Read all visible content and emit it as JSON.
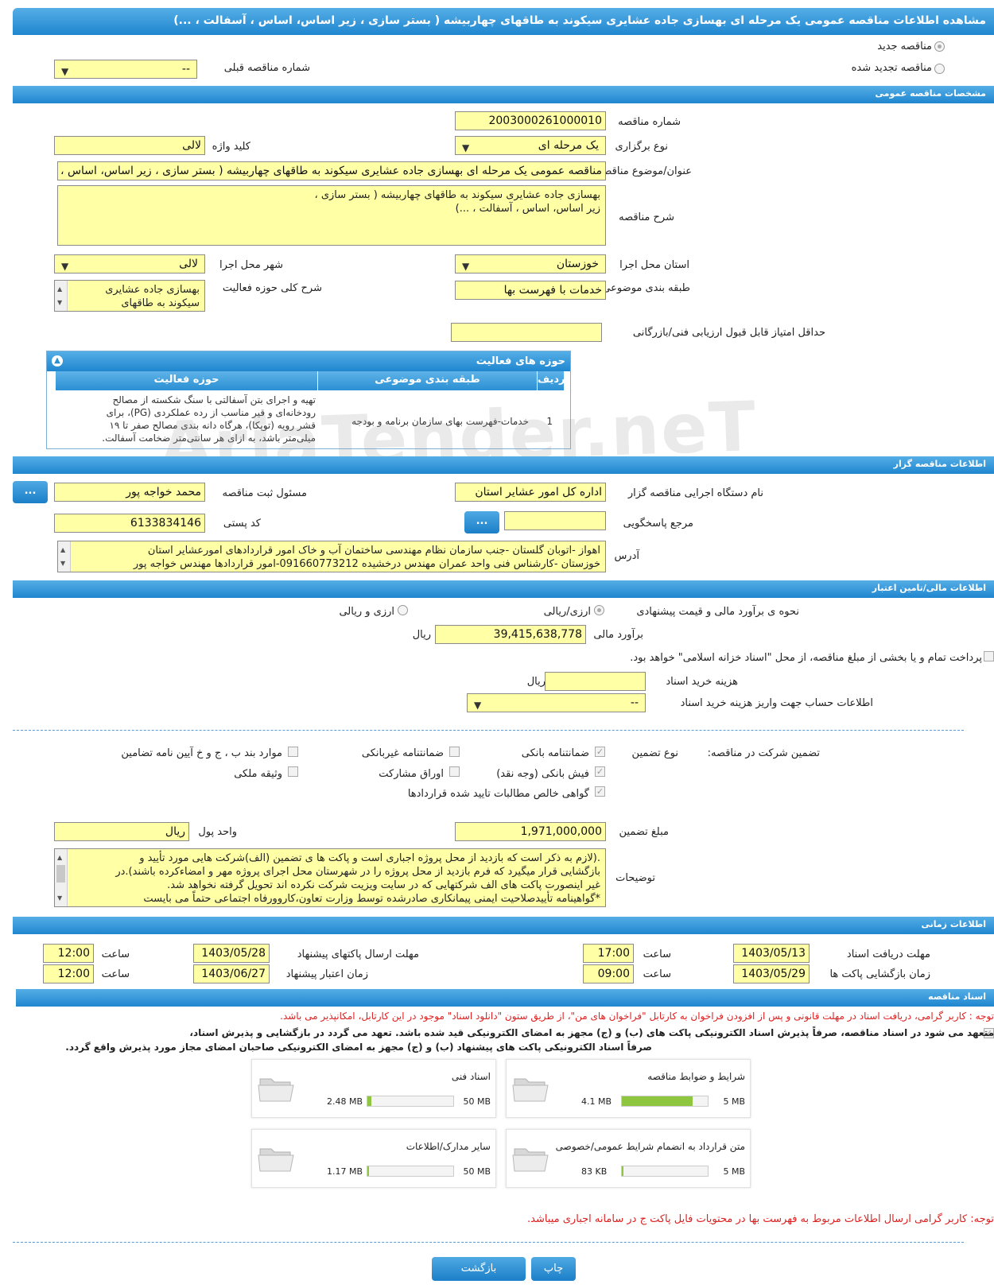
{
  "header": {
    "title": "مشاهده اطلاعات مناقصه عمومی یک مرحله ای بهسازی جاده عشایری سیکوند به طاقهای چهاربیشه ( بستر سازی ، زیر اساس، اساس ، آسفالت ، ...)"
  },
  "tender_type": {
    "new_label": "مناقصه جدید",
    "renewed_label": "مناقصه تجدید شده",
    "prev_number_label": "شماره مناقصه قبلی",
    "prev_number_value": "--"
  },
  "general": {
    "section_title": "مشخصات مناقصه عمومی",
    "tender_number_label": "شماره مناقصه",
    "tender_number": "2003000261000010",
    "holding_type_label": "نوع برگزاری",
    "holding_type": "یک مرحله ای",
    "keyword_label": "کلید واژه",
    "keyword": "لالی",
    "subject_label": "عنوان/موضوع مناقصه",
    "subject": "مناقصه عمومی یک مرحله ای بهسازی جاده عشایری سیکوند به طاقهای چهاربیشه ( بستر سازی ، زیر اساس، اساس ، آسفالت ، ...)",
    "description_label": "شرح مناقصه",
    "description_line1": "بهسازی جاده عشایری سیکوند به طاقهای چهاربیشه ( بستر سازی ،",
    "description_line2": "زیر اساس، اساس ، آسفالت ، ...)",
    "province_label": "استان محل اجرا",
    "province": "خوزستان",
    "city_label": "شهر محل اجرا",
    "city": "لالی",
    "category_label": "طبقه بندی موضوعی",
    "category": "خدمات با فهرست بها",
    "activity_desc_label": "شرح کلی حوزه فعالیت",
    "activity_desc_line1": "بهسازی جاده عشایری",
    "activity_desc_line2": "سیکوند به طاقهای",
    "min_score_label": "حداقل امتیاز قابل قبول ارزیابی فنی/بازرگانی",
    "min_score": ""
  },
  "activity_table": {
    "title": "حوزه های فعالیت",
    "columns": {
      "row": "ردیف",
      "category": "طبقه بندی موضوعی",
      "scope": "حوزه فعالیت"
    },
    "rows": [
      {
        "row": "1",
        "category": "خدمات-فهرست بهای سازمان برنامه و بودجه",
        "scope_line1": "تهیه و اجرای بتن آسفالتی با سنگ شکسته از مصالح",
        "scope_line2": "رودخانه‌ای و قیر مناسب از رده عملکردی (PG)، برای",
        "scope_line3": "قشر رویه (توپکا)، هرگاه دانه بندی مصالح صفر تا ۱۹",
        "scope_line4": "میلی‌متر باشد، به ازای هر سانتی‌متر ضخامت آسفالت."
      }
    ]
  },
  "watermark": "AriaTender.neT",
  "organizer": {
    "section_title": "اطلاعات مناقصه گزار",
    "org_label": "نام دستگاه اجرایی مناقصه گزار",
    "org": "اداره کل امور عشایر استان",
    "registrar_label": "مسئول ثبت مناقصه",
    "registrar": "محمد خواجه پور",
    "reference_label": "مرجع پاسخگویی",
    "reference": "",
    "postal_label": "کد پستی",
    "postal": "6133834146",
    "address_label": "آدرس",
    "address_line1": "اهواز -اتوبان گلستان -جنب سازمان نظام مهندسی ساختمان آب و خاک امور قراردادهای امورعشایر استان",
    "address_line2": "خوزستان -کارشناس فنی واحد عمران مهندس درخشیده 09166077321‪2‬-امور قراردادها مهندس خواجه پور",
    "dots": "..."
  },
  "finance": {
    "section_title": "اطلاعات مالی/تامین اعتبار",
    "estimate_method_label": "نحوه ی برآورد مالی و قیمت پیشنهادی",
    "opt_rial": "ارزی/ریالی",
    "opt_fx": "ارزی و ریالی",
    "estimate_label": "برآورد مالی",
    "estimate": "39,415,638,778",
    "rial": "ریال",
    "treasury_note": "پرداخت تمام و یا بخشی از مبلغ مناقصه، از محل \"اسناد خزانه اسلامی\" خواهد بود.",
    "doc_cost_label": "هزینه خرید اسناد",
    "doc_cost": "",
    "account_label": "اطلاعات حساب جهت واریز هزینه خرید اسناد",
    "account": "--"
  },
  "guarantee": {
    "title_label": "تضمین شرکت در مناقصه:",
    "type_label": "نوع تضمین",
    "bank_guarantee": "ضمانتنامه بانکی",
    "non_bank_guarantee": "ضمانتنامه غیربانکی",
    "items_bcd": "موارد بند ب ، ج و خ آیین نامه تضامین",
    "bank_receipt": "فیش بانکی (وجه نقد)",
    "participation_bonds": "اوراق مشارکت",
    "property": "وثیقه ملکی",
    "net_claims": "گواهی خالص مطالبات تایید شده قراردادها",
    "amount_label": "مبلغ تضمین",
    "amount": "1,971,000,000",
    "currency_label": "واحد پول",
    "currency": "ریال",
    "notes_label": "توضیحات",
    "notes_line1": ".(لازم به ذکر است که بازدید از محل پروژه اجباری است و پاکت ها ی تضمین (الف)شرکت هایی مورد تأیید و",
    "notes_line2": "بازگشایی قرار میگیرد که فرم بازدید از محل پروژه را در شهرستان محل اجرای پروژه مهر و امضاءکرده باشند).در",
    "notes_line3": "غیر اینصورت پاکت های الف شرکتهایی که در سایت ویزیت شرکت نکرده اند تحویل گرفته نخواهد شد.",
    "notes_line4": "*گواهینامه تأییدصلاحیت ایمنی پیمانکاری صادرشده توسط وزارت تعاون،کاروورفاه اجتماعی حتماً می بایست"
  },
  "timing": {
    "section_title": "اطلاعات زمانی",
    "doc_receive_label": "مهلت دریافت اسناد",
    "doc_receive_date": "1403/05/13",
    "doc_receive_time": "17:00",
    "send_label": "مهلت ارسال پاکتهای پیشنهاد",
    "send_date": "1403/05/28",
    "send_time": "12:00",
    "open_label": "زمان بازگشایی پاکت ها",
    "open_date": "1403/05/29",
    "open_time": "09:00",
    "valid_label": "زمان اعتبار پیشنهاد",
    "valid_date": "1403/06/27",
    "valid_time": "12:00",
    "time_label": "ساعت"
  },
  "documents": {
    "section_title": "اسناد مناقصه",
    "notice_red": "توجه : کاربر گرامی، دریافت اسناد در مهلت قانونی و پس از افزودن فراخوان به کارتابل \"فراخوان های من\"، از طریق ستون \"دانلود اسناد\" موجود در این کارتابل، امکانپذیر می باشد.",
    "commit_line1": "متعهد می شود در اسناد مناقصه، صرفاً پذیرش اسناد الکترونیکی پاکت های (ب) و (ج) مجهز به امضای الکترونیکی قید شده باشد. تعهد می گردد در بازگشایی و پذیرش اسناد،",
    "commit_line2": "صرفاً اسناد الکترونیکی پاکت های پیشنهاد (ب) و (ج) مجهز به امضای الکترونیکی صاحبان امضای مجاز مورد پذیرش واقع گردد.",
    "cards": [
      {
        "title": "شرایط و ضوابط مناقصه",
        "used": "4.1 MB",
        "max": "5 MB",
        "fraction": 0.82
      },
      {
        "title": "اسناد فنی",
        "used": "2.48 MB",
        "max": "50 MB",
        "fraction": 0.05
      },
      {
        "title": "متن قرارداد به انضمام شرایط عمومی/خصوصی",
        "used": "83 KB",
        "max": "5 MB",
        "fraction": 0.017
      },
      {
        "title": "سایر مدارک/اطلاعات",
        "used": "1.17 MB",
        "max": "50 MB",
        "fraction": 0.023
      }
    ],
    "notice_bottom": "توجه: کاربر گرامی ارسال اطلاعات مربوط به فهرست بها در محتویات فایل پاکت ج در سامانه اجباری میباشد."
  },
  "footer": {
    "print": "چاپ",
    "back": "بازگشت"
  }
}
